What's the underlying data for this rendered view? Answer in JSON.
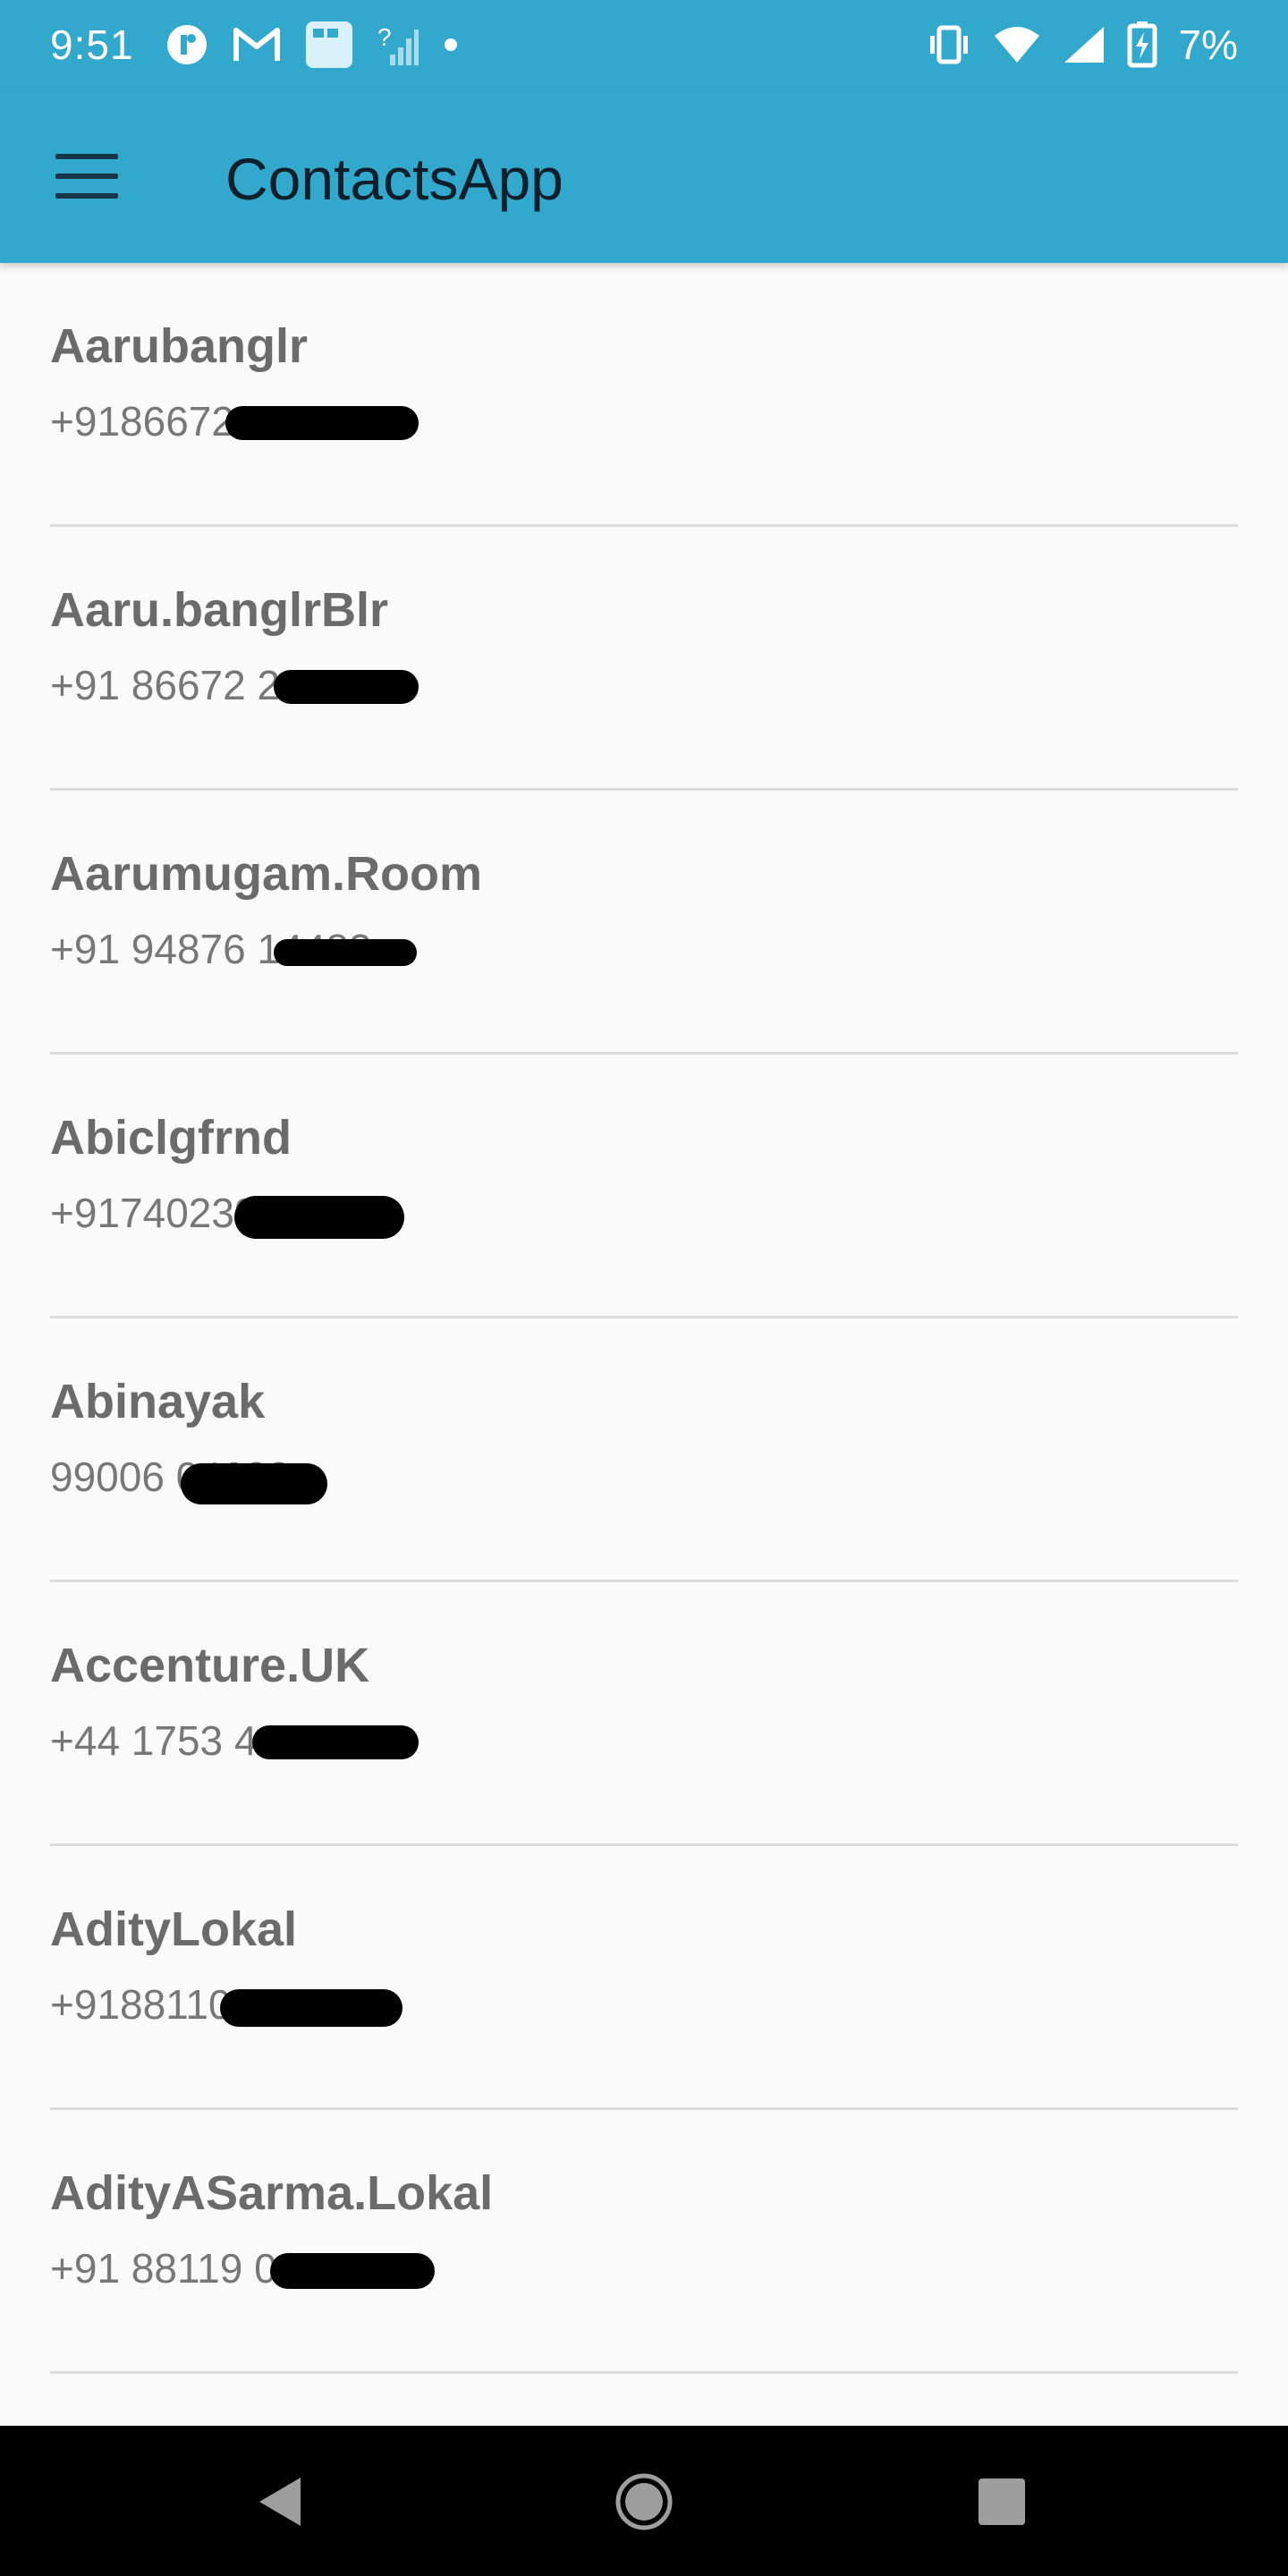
{
  "status_bar": {
    "time": "9:51",
    "battery": "7%",
    "notification_icons": [
      "chat-app-icon",
      "gmail-icon",
      "calendar-icon",
      "no-signal-icon",
      "dot-icon"
    ],
    "system_icons": [
      "vibrate-icon",
      "wifi-icon",
      "cell-signal-icon",
      "battery-charging-icon"
    ]
  },
  "app_bar": {
    "title": "ContactsApp",
    "menu_icon": "hamburger-menu-icon"
  },
  "contacts": [
    {
      "name": "Aarubanglr",
      "phone": "+91866728698"
    },
    {
      "name": "Aaru.banglrBlr",
      "phone": "+91 86672 29982"
    },
    {
      "name": "Aarumugam.Room",
      "phone": "+91 94876 14482"
    },
    {
      "name": "Abiclgfrnd",
      "phone": "+917402398"
    },
    {
      "name": "Abinayak",
      "phone": "99006 04688"
    },
    {
      "name": "Accenture.UK",
      "phone": "+44 1753 417470"
    },
    {
      "name": "AdityLokal",
      "phone": "+918811008175"
    },
    {
      "name": "AdityASarma.Lokal",
      "phone": "+91 88119 00175"
    }
  ],
  "nav_bar": {
    "buttons": [
      "back-icon",
      "home-icon",
      "recents-icon"
    ]
  },
  "colors": {
    "primary": "#33a8cd",
    "title_text": "#0d1f2a",
    "name_text": "#6b6b6b",
    "phone_text": "#777777",
    "divider": "#dcdcdc",
    "background": "#fafafa"
  }
}
